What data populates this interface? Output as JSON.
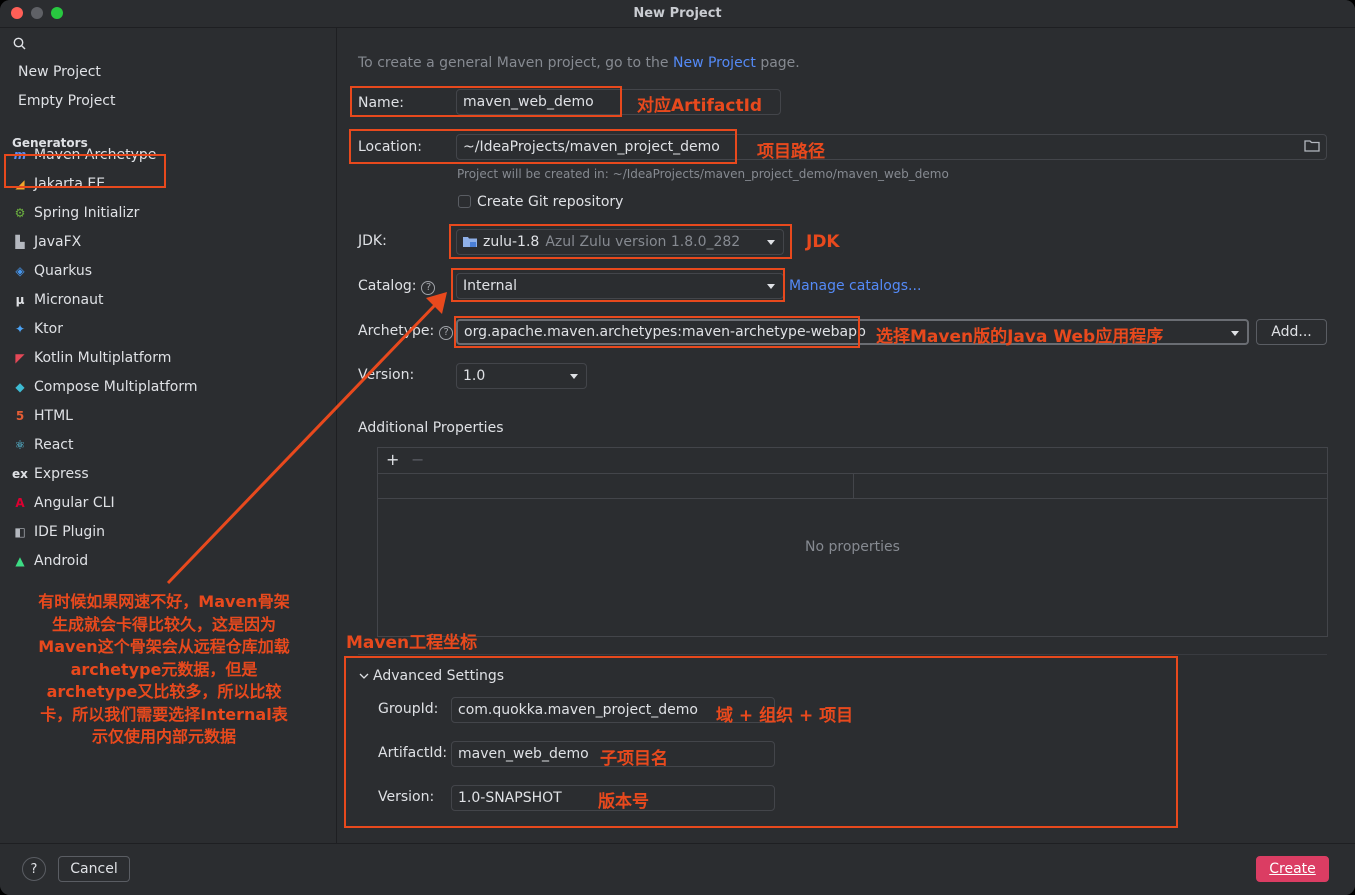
{
  "window": {
    "title": "New Project"
  },
  "sidebar": {
    "search_icon": "search-icon",
    "top_items": [
      {
        "label": "New Project"
      },
      {
        "label": "Empty Project"
      }
    ],
    "generators_header": "Generators",
    "generators": [
      {
        "label": "Maven Archetype",
        "icon": "m",
        "color": "#5c8df6"
      },
      {
        "label": "Jakarta EE",
        "icon": "◢",
        "color": "#f2a62b"
      },
      {
        "label": "Spring Initializr",
        "icon": "⚙",
        "color": "#6db33f"
      },
      {
        "label": "JavaFX",
        "icon": "▙",
        "color": "#b4b8bf"
      },
      {
        "label": "Quarkus",
        "icon": "◈",
        "color": "#4695eb"
      },
      {
        "label": "Micronaut",
        "icon": "μ",
        "color": "#dfe1e5"
      },
      {
        "label": "Ktor",
        "icon": "✦",
        "color": "#4ba3f5"
      },
      {
        "label": "Kotlin Multiplatform",
        "icon": "◤",
        "color": "#e44857"
      },
      {
        "label": "Compose Multiplatform",
        "icon": "◆",
        "color": "#3dbbd3"
      },
      {
        "label": "HTML",
        "icon": "5",
        "color": "#e45d35"
      },
      {
        "label": "React",
        "icon": "⚛",
        "color": "#61dafb"
      },
      {
        "label": "Express",
        "icon": "ex",
        "color": "#dfe1e5"
      },
      {
        "label": "Angular CLI",
        "icon": "A",
        "color": "#dd0031"
      },
      {
        "label": "IDE Plugin",
        "icon": "◧",
        "color": "#b4b8bf"
      },
      {
        "label": "Android",
        "icon": "▲",
        "color": "#3ddc84"
      }
    ]
  },
  "main": {
    "intro_text": "To create a general Maven project, go to the",
    "intro_link": "New Project",
    "intro_suffix": "page.",
    "name_label": "Name:",
    "name_value": "maven_web_demo",
    "location_label": "Location:",
    "location_value": "~/IdeaProjects/maven_project_demo",
    "location_hint": "Project will be created in: ~/IdeaProjects/maven_project_demo/maven_web_demo",
    "git_label": "Create Git repository",
    "jdk_label": "JDK:",
    "jdk_value": "zulu-1.8",
    "jdk_detail": "Azul Zulu version 1.8.0_282",
    "catalog_label": "Catalog:",
    "catalog_value": "Internal",
    "manage_catalogs": "Manage catalogs...",
    "archetype_label": "Archetype:",
    "archetype_value": "org.apache.maven.archetypes:maven-archetype-webapp",
    "add_button": "Add...",
    "version_label": "Version:",
    "version_value": "1.0",
    "additional_properties": "Additional Properties",
    "add_prop": "+",
    "remove_prop": "−",
    "no_properties": "No properties",
    "advanced_settings": "Advanced Settings",
    "groupid_label": "GroupId:",
    "groupid_value": "com.quokka.maven_project_demo",
    "artifactid_label": "ArtifactId:",
    "artifactid_value": "maven_web_demo",
    "adv_version_label": "Version:",
    "adv_version_value": "1.0-SNAPSHOT"
  },
  "footer": {
    "help": "?",
    "cancel": "Cancel",
    "create": "Create"
  },
  "annotations": {
    "name": "对应ArtifactId",
    "location": "项目路径",
    "jdk": "JDK",
    "archetype": "选择Maven版的Java Web应用程序",
    "coords_title": "Maven工程坐标",
    "groupid": "域 + 组织 + 项目",
    "artifactid": "子项目名",
    "version": "版本号",
    "catalog_note": "有时候如果网速不好，Maven骨架生成就会卡得比较久，这是因为Maven这个骨架会从远程仓库加载archetype元数据，但是archetype又比较多，所以比较卡，所以我们需要选择Internal表示仅使用内部元数据"
  },
  "colors": {
    "accent": "#3574f0",
    "annotation": "#e8491d",
    "create_button": "#db3d63",
    "link": "#548af7"
  }
}
